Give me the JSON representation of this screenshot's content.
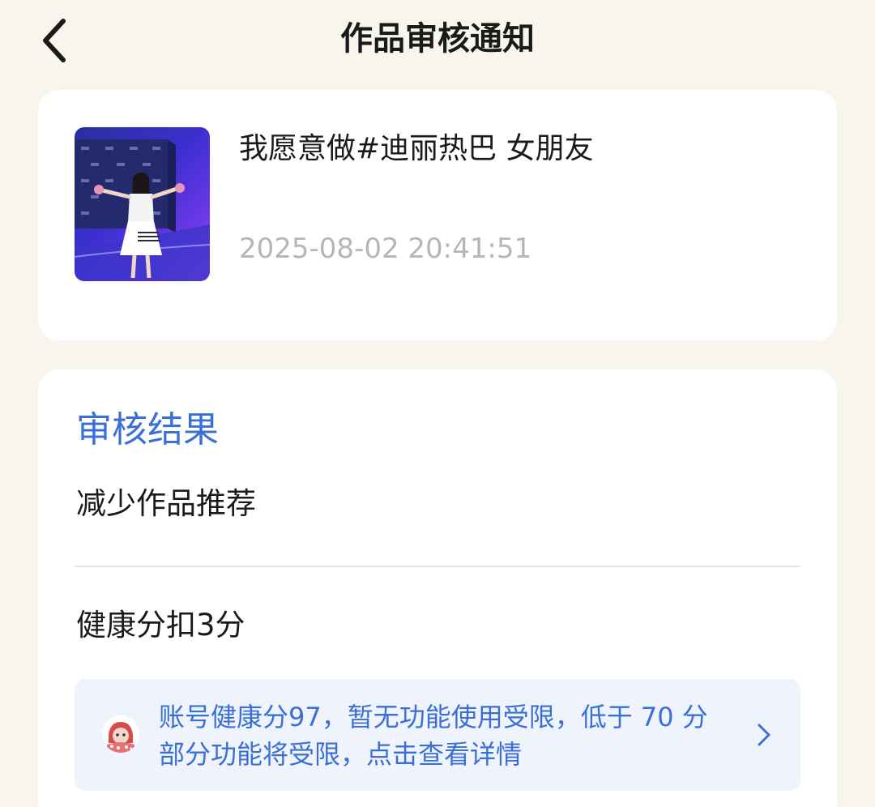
{
  "header": {
    "title": "作品审核通知",
    "back_icon": "chevron-left-icon"
  },
  "work": {
    "title": "我愿意做#迪丽热巴 女朋友",
    "time": "2025-08-02 20:41:51"
  },
  "result": {
    "section_title": "审核结果",
    "action": "减少作品推荐",
    "penalty": "健康分扣3分"
  },
  "notice": {
    "line1": "账号健康分97，暂无功能使用受限，低于 70 分",
    "line2": "部分功能将受限，点击查看详情",
    "chevron_icon": "chevron-right-icon"
  },
  "colors": {
    "background": "#f7f5ec",
    "accent": "#3a6fd8",
    "notice_bg": "#eff3fc",
    "muted_text": "#b6b6b6"
  }
}
